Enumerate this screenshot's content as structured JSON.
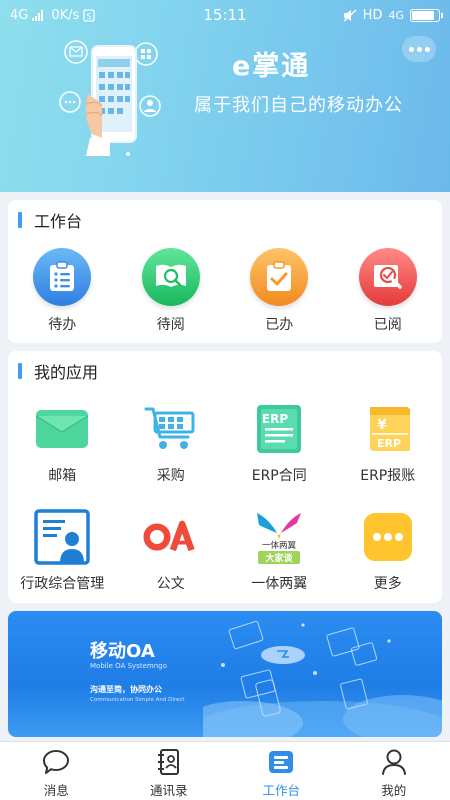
{
  "status_bar": {
    "network": "4G",
    "speed": "0K/s",
    "time": "15:11",
    "hd": "HD",
    "net_right": "4G"
  },
  "header": {
    "app_name": "e掌通",
    "slogan": "属于我们自己的移动办公",
    "more_icon": "more-dots-icon"
  },
  "workbench": {
    "title": "工作台",
    "items": [
      {
        "label": "待办",
        "icon": "todo-clipboard-icon",
        "color": "#3f8fe9"
      },
      {
        "label": "待阅",
        "icon": "to-read-book-icon",
        "color": "#26c46c"
      },
      {
        "label": "已办",
        "icon": "done-clipboard-icon",
        "color": "#f39a2f"
      },
      {
        "label": "已阅",
        "icon": "read-search-icon",
        "color": "#e84c4a"
      }
    ]
  },
  "apps": {
    "title": "我的应用",
    "items": [
      {
        "label": "邮箱",
        "icon": "mail-envelope-icon"
      },
      {
        "label": "采购",
        "icon": "shopping-cart-icon"
      },
      {
        "label": "ERP合同",
        "icon": "erp-contract-icon",
        "badge": "ERP"
      },
      {
        "label": "ERP报账",
        "icon": "erp-reimburse-icon",
        "badge": "ERP"
      },
      {
        "label": "行政综合管理",
        "icon": "admin-management-icon"
      },
      {
        "label": "公文",
        "icon": "oa-document-icon",
        "badge": "OA"
      },
      {
        "label": "一体两翼",
        "icon": "one-body-two-wings-icon",
        "badge_top": "一体两翼",
        "badge_bottom": "大家谈"
      },
      {
        "label": "更多",
        "icon": "more-apps-icon"
      }
    ]
  },
  "banner": {
    "title": "移动OA",
    "subtitle_en": "Mobile OA Systemngo",
    "slogan": "沟通至简，协同办公",
    "slogan_en": "Communication Simple And Direct"
  },
  "tabbar": {
    "items": [
      {
        "label": "消息",
        "icon": "message-bubble-icon",
        "active": false
      },
      {
        "label": "通讯录",
        "icon": "contacts-book-icon",
        "active": false
      },
      {
        "label": "工作台",
        "icon": "workbench-icon",
        "active": true
      },
      {
        "label": "我的",
        "icon": "profile-person-icon",
        "active": false
      }
    ]
  },
  "colors": {
    "accent": "#2f8ee8",
    "header_start": "#8fdfee",
    "header_end": "#6cb9ec"
  }
}
